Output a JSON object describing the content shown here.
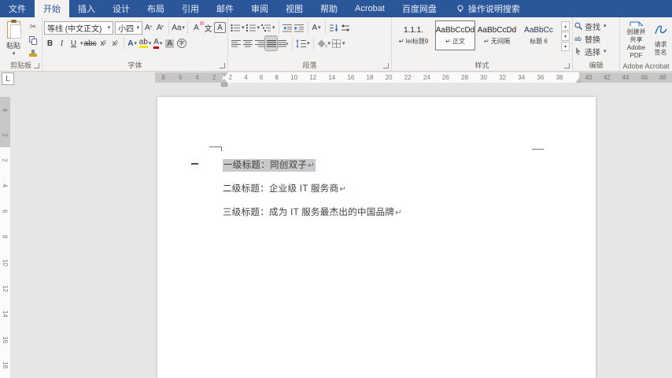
{
  "menu": {
    "tabs": [
      "文件",
      "开始",
      "插入",
      "设计",
      "布局",
      "引用",
      "邮件",
      "审阅",
      "视图",
      "帮助",
      "Acrobat",
      "百度网盘"
    ],
    "assistant": "操作说明搜索"
  },
  "clipboard": {
    "group": "剪贴板",
    "paste": "粘贴"
  },
  "font": {
    "group": "字体",
    "name": "等线 (中文正文)",
    "size": "小四",
    "grow": "A",
    "shrink": "A",
    "case": "Aa",
    "clear": "A",
    "phonetic": "文",
    "char_border": "A",
    "bold": "B",
    "italic": "I",
    "underline": "U",
    "strike": "abc",
    "sub": "x",
    "sub_mark": "2",
    "sup": "x",
    "sup_mark": "2",
    "effects": "A",
    "highlight": "ab",
    "color": "A",
    "char_shading": "A",
    "enclose": "字"
  },
  "paragraph": {
    "group": "段落",
    "asian": "A"
  },
  "styles": {
    "group": "样式",
    "items": [
      {
        "preview": "1.1.1.",
        "name": "↵ lei标题9"
      },
      {
        "preview": "AaBbCcDd",
        "name": "↵ 正文"
      },
      {
        "preview": "AaBbCcDd",
        "name": "↵ 无间隔"
      },
      {
        "preview": "AaBbCc",
        "name": "标题 6"
      }
    ]
  },
  "editing": {
    "group": "编辑",
    "find": "查找",
    "replace": "替换",
    "select": "选择"
  },
  "acrobat": {
    "group": "Adobe Acrobat",
    "create_line1": "创建并共享",
    "create_line2": "Adobe PDF",
    "sign_line1": "请求",
    "sign_line2": "签名"
  },
  "ruler": {
    "tab_selector": "L",
    "left_numbers": [
      "8",
      "6",
      "4",
      "2"
    ],
    "mid_numbers": [
      "2",
      "4",
      "6",
      "8",
      "10",
      "12",
      "14",
      "16",
      "18",
      "20",
      "22",
      "24",
      "26",
      "28",
      "30",
      "32",
      "34",
      "36",
      "38"
    ],
    "right_numbers": [
      "40",
      "42",
      "44",
      "46",
      "48"
    ],
    "v_top_numbers": [
      "4",
      "2"
    ],
    "v_mid_numbers": [
      "2",
      "4",
      "6",
      "8",
      "10",
      "12",
      "14",
      "16",
      "18"
    ]
  },
  "document": {
    "p1": "一级标题：同创双子",
    "p2": "二级标题：企业级 IT 服务商",
    "p3": "三级标题：成为 IT 服务最杰出的中国品牌",
    "mark": "↵"
  }
}
